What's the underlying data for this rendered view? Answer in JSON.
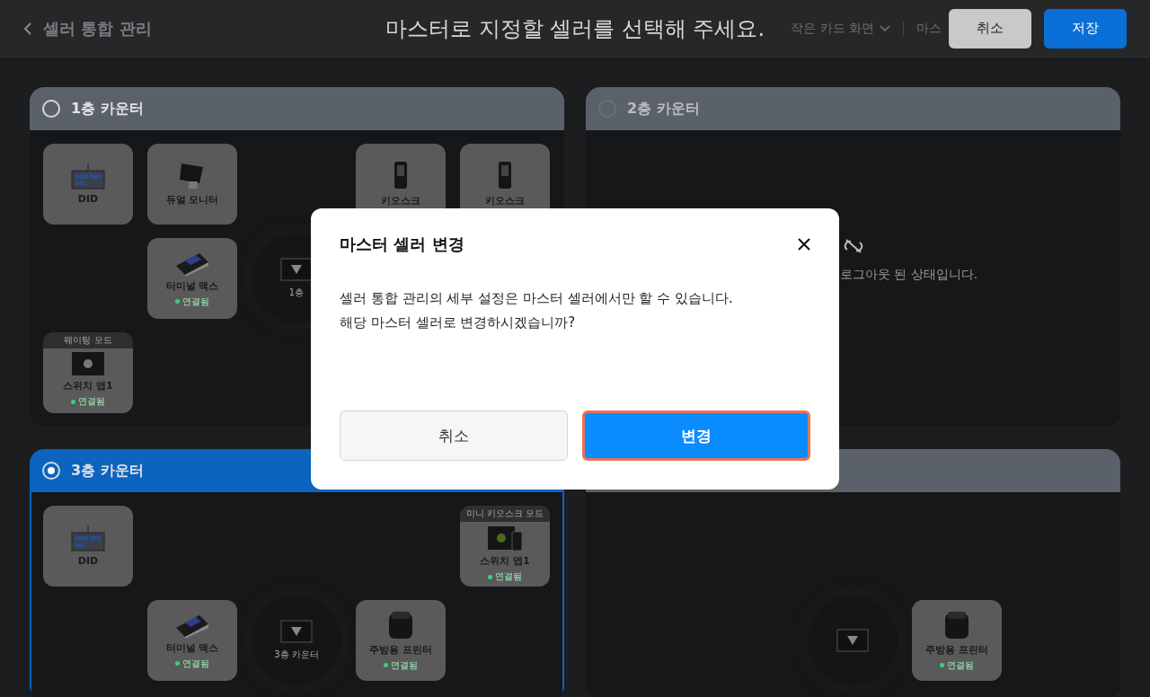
{
  "topbar": {
    "back_label": "셀러 통합 관리",
    "title": "마스터로 지정할 셀러를 선택해 주세요.",
    "view_select": "작은 카드 화면",
    "cut_label": "마스",
    "buttons": [
      {
        "label": "취소",
        "kind": "secondary"
      },
      {
        "label": "저장",
        "kind": "primary"
      }
    ]
  },
  "panels": [
    {
      "title": "1층 카운터",
      "selected": false,
      "disabled": false,
      "rows": [
        [
          {
            "kind": "did",
            "name": "DID"
          },
          {
            "kind": "dual-monitor",
            "name": "듀얼 모니터"
          },
          {
            "kind": "empty"
          },
          {
            "kind": "kiosk",
            "name": "키오스크"
          },
          {
            "kind": "kiosk",
            "name": "키오스크"
          }
        ],
        [
          {
            "kind": "empty"
          },
          {
            "kind": "terminal",
            "name": "터미널 맥스",
            "status": "연결됨"
          },
          {
            "kind": "hub",
            "label": "1층"
          },
          {
            "kind": "empty"
          },
          {
            "kind": "empty"
          }
        ],
        [
          {
            "kind": "app-apple",
            "name": "스위치 앱1",
            "status": "연결됨",
            "badge": "웨이팅 모드"
          },
          {
            "kind": "empty"
          },
          {
            "kind": "empty"
          },
          {
            "kind": "empty"
          },
          {
            "kind": "empty"
          }
        ]
      ]
    },
    {
      "title": "2층 카운터",
      "selected": false,
      "disabled": true,
      "message": "로그아웃 된 상태입니다."
    },
    {
      "title": "3층 카운터",
      "selected": true,
      "disabled": false,
      "rows": [
        [
          {
            "kind": "did",
            "name": "DID"
          },
          {
            "kind": "empty"
          },
          {
            "kind": "empty"
          },
          {
            "kind": "empty"
          },
          {
            "kind": "app-android",
            "name": "스위치 앱1",
            "status": "연결됨",
            "badge": "미니 키오스크 모드"
          }
        ],
        [
          {
            "kind": "empty"
          },
          {
            "kind": "terminal",
            "name": "터미널 맥스",
            "status": "연결됨"
          },
          {
            "kind": "hub",
            "label": "3층 카운터"
          },
          {
            "kind": "printer",
            "name": "주방용 프린터",
            "status": "연결됨"
          },
          {
            "kind": "empty"
          }
        ]
      ]
    },
    {
      "selected": false,
      "rows": [
        [
          {
            "kind": "empty"
          },
          {
            "kind": "empty"
          },
          {
            "kind": "empty"
          },
          {
            "kind": "empty"
          },
          {
            "kind": "empty"
          }
        ],
        [
          {
            "kind": "empty"
          },
          {
            "kind": "empty"
          },
          {
            "kind": "hub"
          },
          {
            "kind": "printer",
            "name": "주방용 프린터",
            "status": "연결됨"
          },
          {
            "kind": "empty"
          }
        ]
      ]
    }
  ],
  "dialog": {
    "title": "마스터 셀러 변경",
    "message": [
      "셀러 통합 관리의 세부 설정은 마스터 셀러에서만 할 수 있습니다.",
      "해당 마스터 셀러로 변경하시겠습니까?"
    ],
    "buttons": [
      {
        "label": "취소",
        "kind": "cancel",
        "highlighted": false
      },
      {
        "label": "변경",
        "kind": "confirm",
        "highlighted": true
      }
    ]
  }
}
